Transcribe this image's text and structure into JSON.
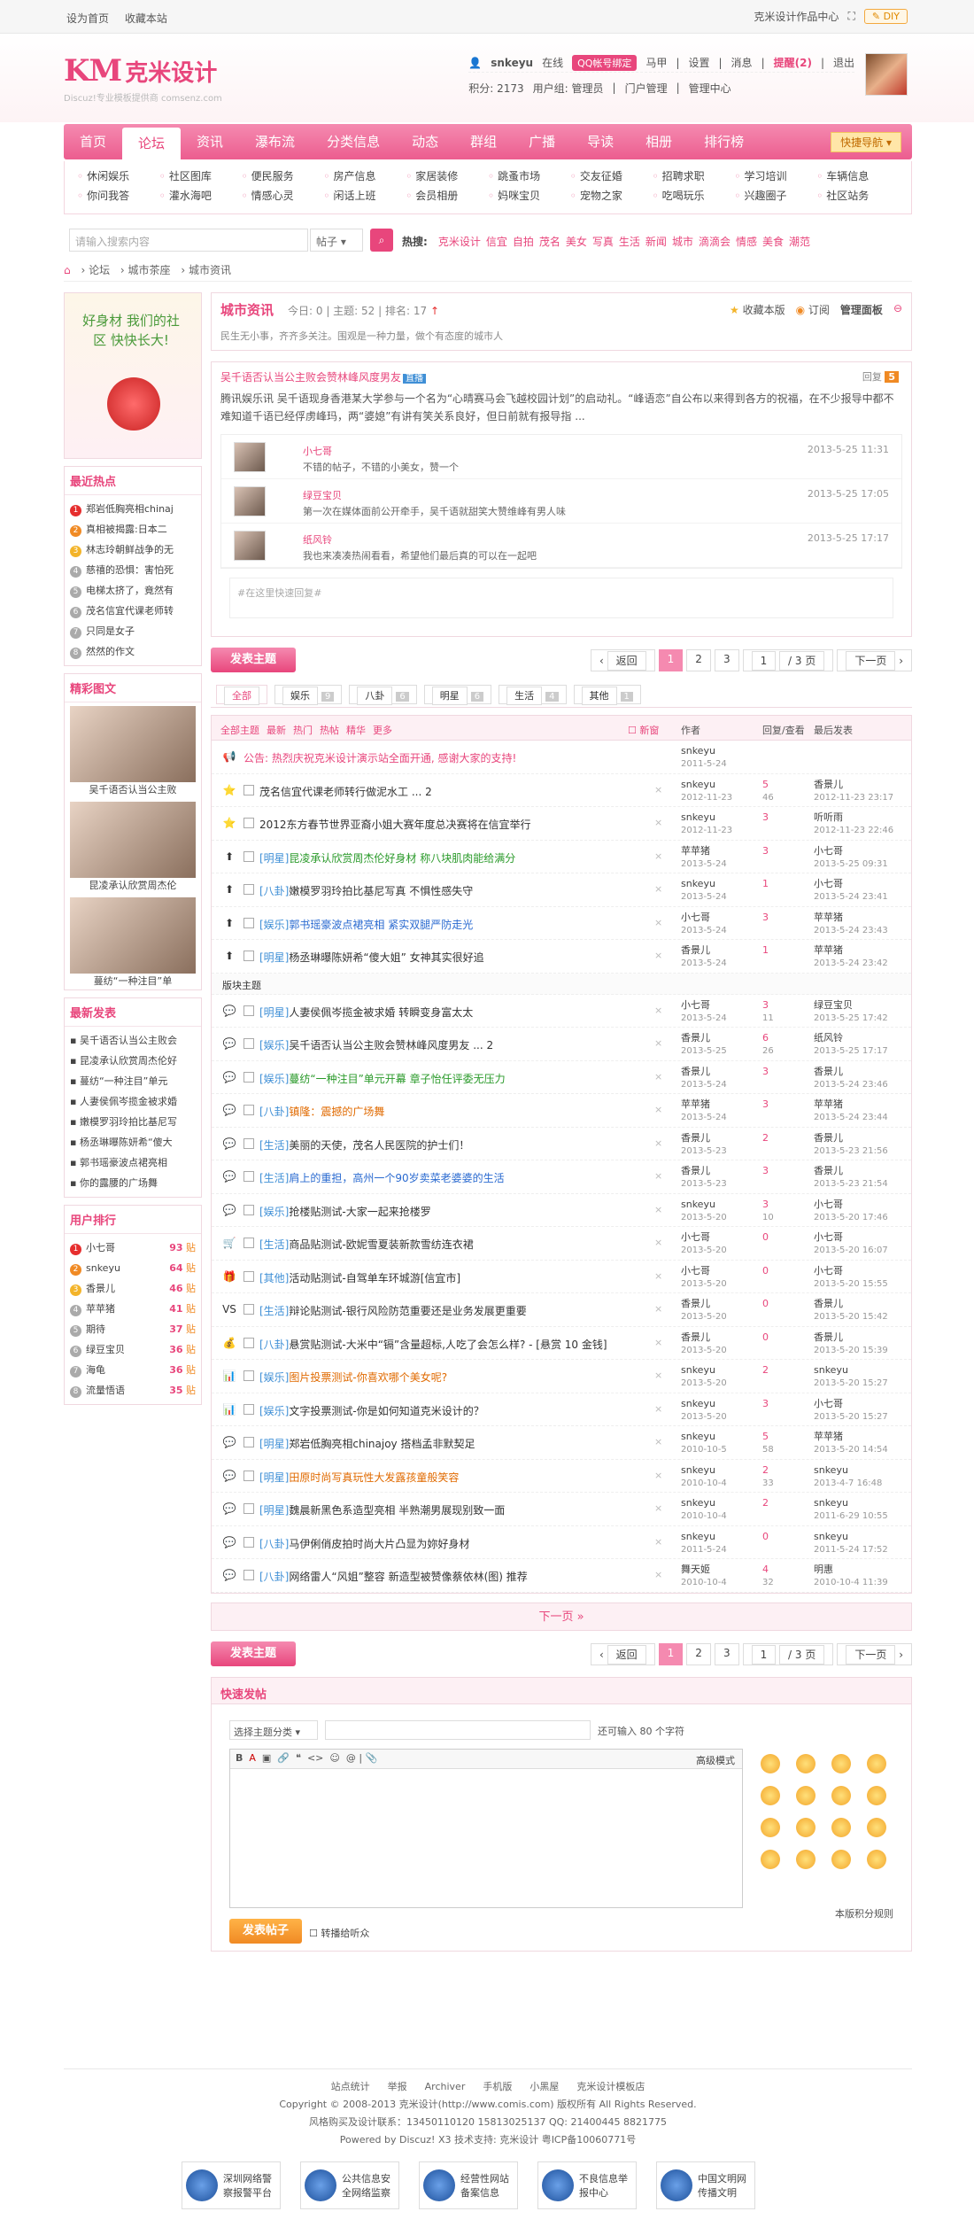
{
  "topbar": {
    "left": [
      "设为首页",
      "收藏本站"
    ],
    "right": "克米设计作品中心",
    "diy": "DIY"
  },
  "logo": {
    "mark": "KM",
    "name": "克米设计",
    "sub": "Discuz!专业模板提供商 comsenz.com"
  },
  "user": {
    "name": "snkeyu",
    "online": "在线",
    "qq": "QQ帐号绑定",
    "items": [
      "马甲",
      "设置",
      "消息"
    ],
    "remind": "提醒(2)",
    "logout": "退出",
    "credits": "积分: 2173",
    "group": "用户组: 管理员",
    "portal": "门户管理",
    "admin": "管理中心"
  },
  "nav": {
    "items": [
      "首页",
      "论坛",
      "资讯",
      "瀑布流",
      "分类信息",
      "动态",
      "群组",
      "广播",
      "导读",
      "相册",
      "排行榜"
    ],
    "quick": "快捷导航"
  },
  "subnav": [
    "休闲娱乐",
    "社区图库",
    "便民服务",
    "房产信息",
    "家居装修",
    "跳蚤市场",
    "交友征婚",
    "招聘求职",
    "学习培训",
    "车辆信息",
    "你问我答",
    "灌水海吧",
    "情感心灵",
    "闲话上班",
    "会员相册",
    "妈咪宝贝",
    "宠物之家",
    "吃喝玩乐",
    "兴趣圈子",
    "社区站务"
  ],
  "search": {
    "placeholder": "请输入搜索内容",
    "type": "帖子",
    "hotlabel": "热搜:",
    "hot": [
      "克米设计",
      "信宜",
      "自拍",
      "茂名",
      "美女",
      "写真",
      "生活",
      "新闻",
      "城市",
      "滴滴会",
      "情感",
      "美食",
      "潮范"
    ]
  },
  "crumb": [
    "论坛",
    "城市茶座",
    "城市资讯"
  ],
  "side": {
    "banner": "好身材 我们的社区 快快长大!",
    "hot_title": "最近热点",
    "hot": [
      "郑岩低胸亮相chinaj",
      "真相被揭露:日本二",
      "林志玲朝鲜战争的无",
      "慈禧的恐惧：害怕死",
      "电梯太挤了，竟然有",
      "茂名信宜代课老师转",
      "只同是女子",
      "然然的作文"
    ],
    "pic_title": "精彩图文",
    "pics": [
      "吴千语否认当公主败",
      "昆凌承认欣赏周杰伦",
      "蔓纺“一种注目”单"
    ],
    "new_title": "最新发表",
    "new": [
      "吴千语否认当公主败会",
      "昆凌承认欣赏周杰伦好",
      "蔓纺“一种注目”单元",
      "人妻侯佩岑揽金被求婚",
      "嫩模罗羽玲拍比基尼写",
      "杨丞琳曝陈妍希“傻大",
      "郭书瑶豪波点裙亮相",
      "你的露腰的广场舞"
    ],
    "rank_title": "用户排行",
    "rank": [
      {
        "n": "小七哥",
        "p": "93"
      },
      {
        "n": "snkeyu",
        "p": "64"
      },
      {
        "n": "香景儿",
        "p": "46"
      },
      {
        "n": "苹苹猪",
        "p": "41"
      },
      {
        "n": "期待",
        "p": "37"
      },
      {
        "n": "绿豆宝贝",
        "p": "36"
      },
      {
        "n": "海龟",
        "p": "36"
      },
      {
        "n": "流量悟语",
        "p": "35"
      }
    ],
    "rank_unit": "贴"
  },
  "forum": {
    "title": "城市资讯",
    "today": "今日: 0",
    "topics": "主题: 52",
    "rank": "排名: 17",
    "desc": "民生无小事，齐齐多关注。围观是一种力量，做个有态度的城市人",
    "fav": "收藏本版",
    "rss": "订阅",
    "manage": "管理面板"
  },
  "sticky": {
    "title": "吴千语否认当公主败会赞林峰风度男友",
    "tag": "直播",
    "reply": "回复",
    "replycount": "5",
    "body": "腾讯娱乐讯 吴千语现身香港某大学参与一个名为“心晴赛马会飞越校园计划”的启动礼。“峰语恋”自公布以来得到各方的祝福，在不少报导中都不难知道千语已经俘虏峰玛，两“婆媳”有讲有笑关系良好，但日前就有报导指 ...",
    "comments": [
      {
        "u": "小七哥",
        "t": "不错的帖子，不错的小美女，赞一个",
        "tm": "2013-5-25 11:31"
      },
      {
        "u": "绿豆宝贝",
        "t": "第一次在媒体面前公开牵手，吴千语就甜笑大赞维峰有男人味",
        "tm": "2013-5-25 17:05"
      },
      {
        "u": "纸风铃",
        "t": "我也来凑凑热闹看看，希望他们最后真的可以在一起吧",
        "tm": "2013-5-25 17:17"
      }
    ],
    "quick": "#在这里快速回复#"
  },
  "pager": {
    "post": "发表主题",
    "back": "返回",
    "pages": [
      "1",
      "2",
      "3"
    ],
    "input": "1",
    "total": "/ 3 页",
    "next": "下一页"
  },
  "types": [
    {
      "n": "全部",
      "c": ""
    },
    {
      "n": "娱乐",
      "c": "9"
    },
    {
      "n": "八卦",
      "c": "6"
    },
    {
      "n": "明星",
      "c": "6"
    },
    {
      "n": "生活",
      "c": "4"
    },
    {
      "n": "其他",
      "c": "1"
    }
  ],
  "thead": {
    "filters": [
      "全部主题",
      "最新",
      "热门",
      "热帖",
      "精华",
      "更多"
    ],
    "new": "新窗",
    "author": "作者",
    "replies": "回复/查看",
    "last": "最后发表"
  },
  "threads": [
    {
      "ic": "📢",
      "cat": "",
      "t": "公告: 热烈庆祝克米设计演示站全面开通, 感谢大家的支持!",
      "cls": "hl",
      "a": "snkeyu",
      "ad": "2011-5-24",
      "r": "",
      "v": "",
      "lp": "",
      "ld": ""
    },
    {
      "ic": "⭐",
      "cat": "",
      "t": "茂名信宜代课老师转行做泥水工 ... 2",
      "cls": "",
      "a": "snkeyu",
      "ad": "2012-11-23",
      "r": "5",
      "v": "46",
      "lp": "香景儿",
      "ld": "2012-11-23 23:17"
    },
    {
      "ic": "⭐",
      "cat": "",
      "t": "2012东方春节世界亚裔小姐大赛年度总决赛将在信宜举行",
      "cls": "",
      "a": "snkeyu",
      "ad": "2012-11-23",
      "r": "3",
      "v": "",
      "lp": "听听雨",
      "ld": "2012-11-23 22:46"
    },
    {
      "ic": "⬆",
      "cat": "[明星]",
      "t": "昆凌承认欣赏周杰伦好身材 称八块肌肉能给满分",
      "cls": "gr",
      "a": "苹苹猪",
      "ad": "2013-5-24",
      "r": "3",
      "v": "",
      "lp": "小七哥",
      "ld": "2013-5-25 09:31"
    },
    {
      "ic": "⬆",
      "cat": "[八卦]",
      "t": "嫩模罗羽玲拍比基尼写真 不惧性感失守",
      "cls": "",
      "a": "snkeyu",
      "ad": "2013-5-24",
      "r": "1",
      "v": "",
      "lp": "小七哥",
      "ld": "2013-5-24 23:41"
    },
    {
      "ic": "⬆",
      "cat": "[娱乐]",
      "t": "郭书瑶豪波点裙亮相 紧实双腿严防走光",
      "cls": "bl",
      "a": "小七哥",
      "ad": "2013-5-24",
      "r": "3",
      "v": "",
      "lp": "苹苹猪",
      "ld": "2013-5-24 23:43"
    },
    {
      "ic": "⬆",
      "cat": "[明星]",
      "t": "杨丞琳曝陈妍希“傻大姐” 女神其实很好追",
      "cls": "",
      "a": "香景儿",
      "ad": "2013-5-24",
      "r": "1",
      "v": "",
      "lp": "苹苹猪",
      "ld": "2013-5-24 23:42"
    },
    {
      "sep": true,
      "t": "版块主题"
    },
    {
      "ic": "💬",
      "cat": "[明星]",
      "t": "人妻侯佩岑揽金被求婚 转瞬变身富太太",
      "cls": "",
      "a": "小七哥",
      "ad": "2013-5-24",
      "r": "3",
      "v": "11",
      "lp": "绿豆宝贝",
      "ld": "2013-5-25 17:42"
    },
    {
      "ic": "💬",
      "cat": "[娱乐]",
      "t": "吴千语否认当公主败会赞林峰风度男友 ... 2",
      "cls": "",
      "a": "香景儿",
      "ad": "2013-5-25",
      "r": "6",
      "v": "26",
      "lp": "纸风铃",
      "ld": "2013-5-25 17:17"
    },
    {
      "ic": "💬",
      "cat": "[娱乐]",
      "t": "蔓纺“一种注目”单元开幕 章子怡任评委无压力",
      "cls": "gr",
      "a": "香景儿",
      "ad": "2013-5-24",
      "r": "3",
      "v": "",
      "lp": "香景儿",
      "ld": "2013-5-24 23:46"
    },
    {
      "ic": "💬",
      "cat": "[八卦]",
      "t": "镇隆：震撼的广场舞",
      "cls": "or",
      "a": "苹苹猪",
      "ad": "2013-5-24",
      "r": "3",
      "v": "",
      "lp": "苹苹猪",
      "ld": "2013-5-24 23:44"
    },
    {
      "ic": "💬",
      "cat": "[生活]",
      "t": "美丽的天使，茂名人民医院的护士们！",
      "cls": "",
      "a": "香景儿",
      "ad": "2013-5-23",
      "r": "2",
      "v": "",
      "lp": "香景儿",
      "ld": "2013-5-23 21:56"
    },
    {
      "ic": "💬",
      "cat": "[生活]",
      "t": "肩上的重担，高州一个90岁卖菜老婆婆的生活",
      "cls": "bl",
      "a": "香景儿",
      "ad": "2013-5-23",
      "r": "3",
      "v": "",
      "lp": "香景儿",
      "ld": "2013-5-23 21:54"
    },
    {
      "ic": "💬",
      "cat": "[娱乐]",
      "t": "抢楼贴测试-大家一起来抢楼罗",
      "cls": "",
      "a": "snkeyu",
      "ad": "2013-5-20",
      "r": "3",
      "v": "10",
      "lp": "小七哥",
      "ld": "2013-5-20 17:46"
    },
    {
      "ic": "🛒",
      "cat": "[生活]",
      "t": "商品贴测试-欧妮雪夏装新款雪纺连衣裙",
      "cls": "",
      "a": "小七哥",
      "ad": "2013-5-20",
      "r": "0",
      "v": "",
      "lp": "小七哥",
      "ld": "2013-5-20 16:07"
    },
    {
      "ic": "🎁",
      "cat": "[其他]",
      "t": "活动贴测试-自驾单车环城游[信宜市]",
      "cls": "",
      "a": "小七哥",
      "ad": "2013-5-20",
      "r": "0",
      "v": "",
      "lp": "小七哥",
      "ld": "2013-5-20 15:55"
    },
    {
      "ic": "VS",
      "cat": "[生活]",
      "t": "辩论贴测试-银行风险防范重要还是业务发展更重要",
      "cls": "",
      "a": "香景儿",
      "ad": "2013-5-20",
      "r": "0",
      "v": "",
      "lp": "香景儿",
      "ld": "2013-5-20 15:42"
    },
    {
      "ic": "💰",
      "cat": "[八卦]",
      "t": "悬赏贴测试-大米中“镉”含量超标,人吃了会怎么样? - [悬赏 10 金钱]",
      "cls": "",
      "a": "香景儿",
      "ad": "2013-5-20",
      "r": "0",
      "v": "",
      "lp": "香景儿",
      "ld": "2013-5-20 15:39"
    },
    {
      "ic": "📊",
      "cat": "[娱乐]",
      "t": "图片投票测试-你喜欢哪个美女呢?",
      "cls": "or",
      "a": "snkeyu",
      "ad": "2013-5-20",
      "r": "2",
      "v": "",
      "lp": "snkeyu",
      "ld": "2013-5-20 15:27"
    },
    {
      "ic": "📊",
      "cat": "[娱乐]",
      "t": "文字投票测试-你是如何知道克米设计的？",
      "cls": "",
      "a": "snkeyu",
      "ad": "2013-5-20",
      "r": "3",
      "v": "",
      "lp": "小七哥",
      "ld": "2013-5-20 15:27"
    },
    {
      "ic": "💬",
      "cat": "[明星]",
      "t": "郑岩低胸亮相chinajoy 搭档孟非默契足",
      "cls": "",
      "a": "snkeyu",
      "ad": "2010-10-5",
      "r": "5",
      "v": "58",
      "lp": "苹苹猪",
      "ld": "2013-5-20 14:54"
    },
    {
      "ic": "💬",
      "cat": "[明星]",
      "t": "田原时尚写真玩性大发露孩童般笑容",
      "cls": "or",
      "a": "snkeyu",
      "ad": "2010-10-4",
      "r": "2",
      "v": "33",
      "lp": "snkeyu",
      "ld": "2013-4-7 16:48"
    },
    {
      "ic": "💬",
      "cat": "[明星]",
      "t": "魏晨新黑色系造型亮相 半熟潮男展现别致一面",
      "cls": "",
      "a": "snkeyu",
      "ad": "2010-10-4",
      "r": "2",
      "v": "",
      "lp": "snkeyu",
      "ld": "2011-6-29 10:55"
    },
    {
      "ic": "💬",
      "cat": "[八卦]",
      "t": "马伊俐俏皮拍时尚大片凸显为妳好身材",
      "cls": "",
      "a": "snkeyu",
      "ad": "2011-5-24",
      "r": "0",
      "v": "",
      "lp": "snkeyu",
      "ld": "2011-5-24 17:52"
    },
    {
      "ic": "💬",
      "cat": "[八卦]",
      "t": "网络雷人“风姐”整容 新造型被赞像蔡依林(图) 推荐",
      "cls": "",
      "a": "舞天姬",
      "ad": "2010-10-4",
      "r": "4",
      "v": "32",
      "lp": "明惠",
      "ld": "2010-10-4 11:39"
    }
  ],
  "nextpage": "下一页 »",
  "fast": {
    "title": "快速发帖",
    "select": "选择主题分类",
    "limit": "还可输入 80 个字符",
    "adv": "高级模式",
    "submit": "发表帖子",
    "check": "转播给听众",
    "rule": "本版积分规则"
  },
  "footer": {
    "links": [
      "站点统计",
      "举报",
      "Archiver",
      "手机版",
      "小黑屋",
      "克米设计模板店"
    ],
    "copy": "Copyright © 2008-2013 克米设计(http://www.comis.com) 版权所有 All Rights Reserved.",
    "contact": "风格购买及设计联系：13450110120 15813025137 QQ: 21400445 8821775",
    "power": "Powered by Discuz! X3  技术支持: 克米设计  粤ICP备10060771号"
  },
  "badges": [
    "深圳网络警察报警平台",
    "公共信息安全网络监察",
    "经营性网站备案信息",
    "不良信息举报中心",
    "中国文明网传播文明"
  ]
}
